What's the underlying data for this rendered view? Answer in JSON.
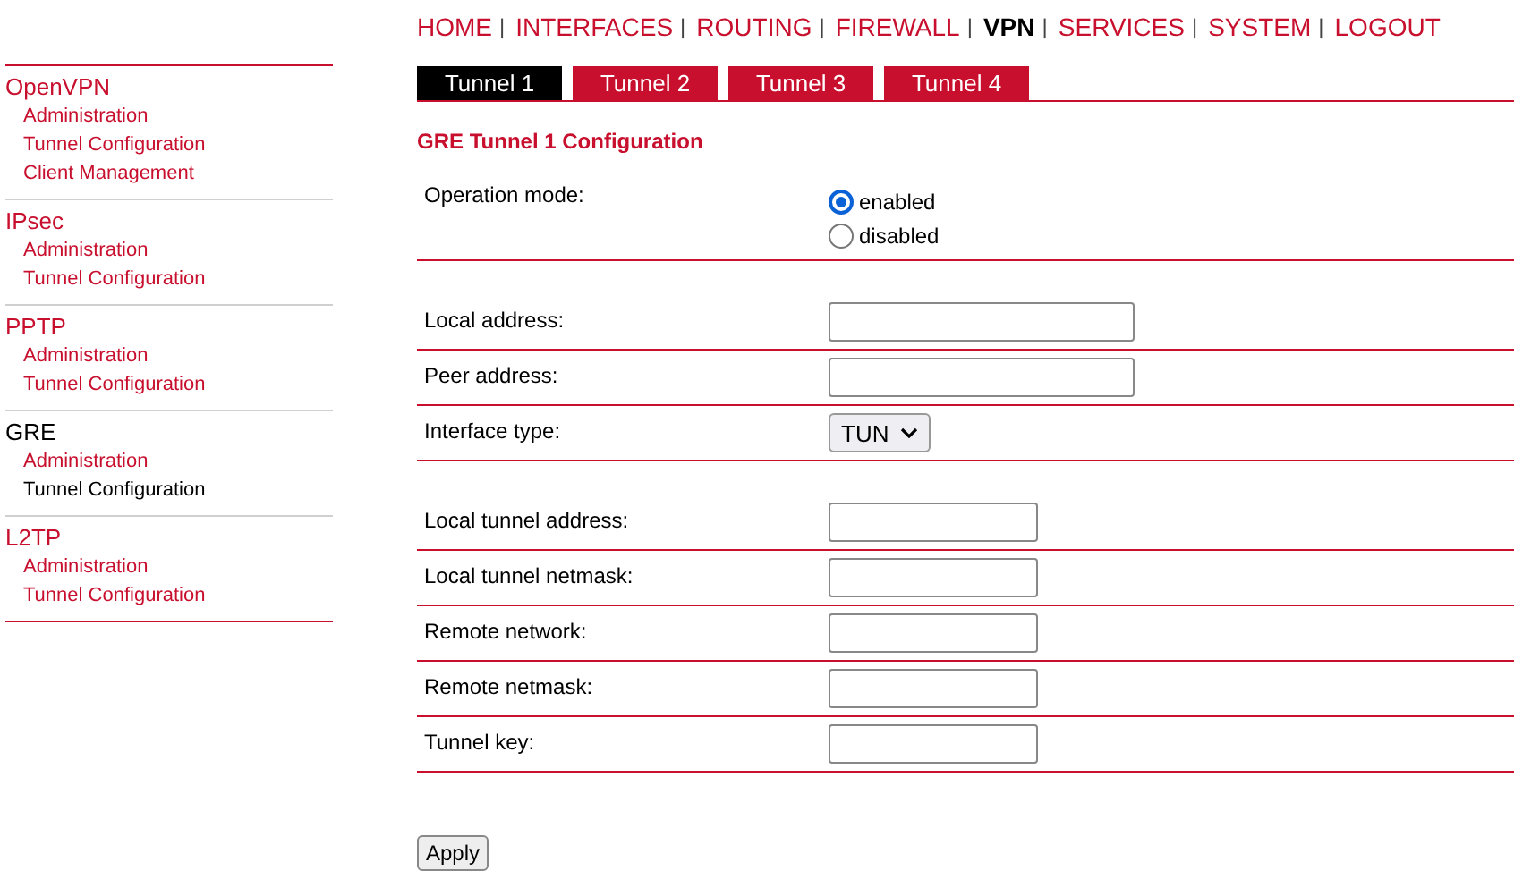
{
  "nav": {
    "separator": "|",
    "items": [
      {
        "label": "HOME",
        "selected": false
      },
      {
        "label": "INTERFACES",
        "selected": false
      },
      {
        "label": "ROUTING",
        "selected": false
      },
      {
        "label": "FIREWALL",
        "selected": false
      },
      {
        "label": "VPN",
        "selected": true
      },
      {
        "label": "SERVICES",
        "selected": false
      },
      {
        "label": "SYSTEM",
        "selected": false
      },
      {
        "label": "LOGOUT",
        "selected": false
      }
    ]
  },
  "sidebar": {
    "groups": [
      {
        "title": "OpenVPN",
        "selected": false,
        "items": [
          {
            "label": "Administration",
            "selected": false
          },
          {
            "label": "Tunnel Configuration",
            "selected": false
          },
          {
            "label": "Client Management",
            "selected": false
          }
        ]
      },
      {
        "title": "IPsec",
        "selected": false,
        "items": [
          {
            "label": "Administration",
            "selected": false
          },
          {
            "label": "Tunnel Configuration",
            "selected": false
          }
        ]
      },
      {
        "title": "PPTP",
        "selected": false,
        "items": [
          {
            "label": "Administration",
            "selected": false
          },
          {
            "label": "Tunnel Configuration",
            "selected": false
          }
        ]
      },
      {
        "title": "GRE",
        "selected": true,
        "items": [
          {
            "label": "Administration",
            "selected": false
          },
          {
            "label": "Tunnel Configuration",
            "selected": true
          }
        ]
      },
      {
        "title": "L2TP",
        "selected": false,
        "items": [
          {
            "label": "Administration",
            "selected": false
          },
          {
            "label": "Tunnel Configuration",
            "selected": false
          }
        ]
      }
    ]
  },
  "tabs": [
    {
      "label": "Tunnel 1",
      "selected": true
    },
    {
      "label": "Tunnel 2",
      "selected": false
    },
    {
      "label": "Tunnel 3",
      "selected": false
    },
    {
      "label": "Tunnel 4",
      "selected": false
    }
  ],
  "form": {
    "title": "GRE Tunnel 1 Configuration",
    "sections": [
      {
        "rows": [
          {
            "kind": "radio",
            "label": "Operation mode:",
            "options": [
              {
                "label": "enabled",
                "selected": true
              },
              {
                "label": "disabled",
                "selected": false
              }
            ]
          }
        ]
      },
      {
        "rows": [
          {
            "kind": "text",
            "label": "Local address:"
          },
          {
            "kind": "text",
            "label": "Peer address:"
          },
          {
            "kind": "select",
            "label": "Interface type:",
            "value": "TUN"
          }
        ]
      },
      {
        "rows": [
          {
            "kind": "text",
            "label": "Local tunnel address:"
          },
          {
            "kind": "text",
            "label": "Local tunnel netmask:"
          },
          {
            "kind": "text",
            "label": "Remote network:"
          },
          {
            "kind": "text",
            "label": "Remote netmask:"
          },
          {
            "kind": "text",
            "label": "Tunnel key:"
          }
        ]
      }
    ]
  },
  "apply_button": "Apply"
}
